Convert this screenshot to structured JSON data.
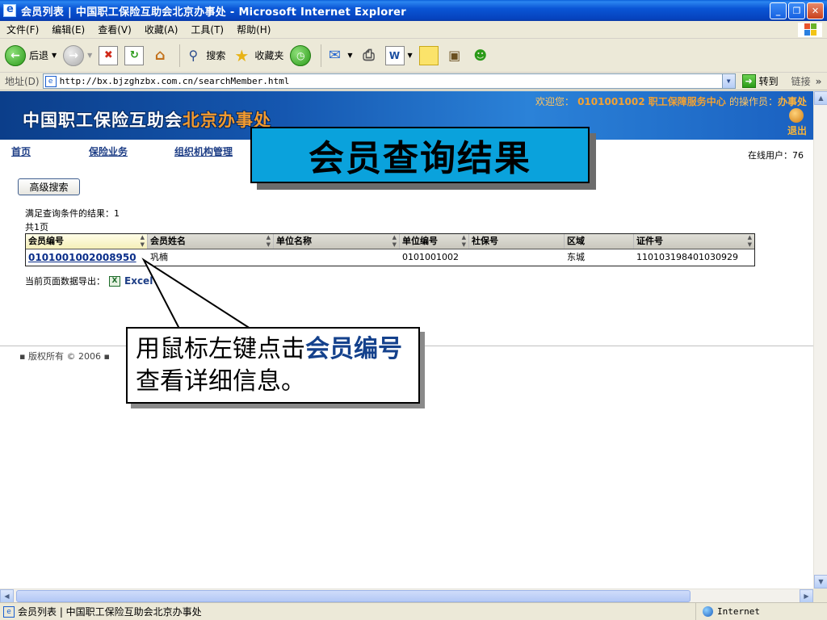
{
  "window": {
    "title": "会员列表 | 中国职工保险互助会北京办事处 - Microsoft Internet Explorer",
    "minimize": "_",
    "maximize": "❐",
    "close": "✕"
  },
  "menu": [
    {
      "label": "文件(F)"
    },
    {
      "label": "编辑(E)"
    },
    {
      "label": "查看(V)"
    },
    {
      "label": "收藏(A)"
    },
    {
      "label": "工具(T)"
    },
    {
      "label": "帮助(H)"
    }
  ],
  "toolbar": {
    "back": "后退",
    "search": "搜索",
    "favorites": "收藏夹"
  },
  "address": {
    "label": "地址(D)",
    "url": "http://bx.bjzghzbx.com.cn/searchMember.html",
    "go": "转到",
    "links": "链接"
  },
  "site": {
    "logo_main": "中国职工保险互助会",
    "logo_accent": "北京办事处",
    "welcome_prefix": "欢迎您：",
    "welcome_account": "0101001002",
    "welcome_org": "职工保障服务中心",
    "welcome_operator_label": "的操作员：",
    "welcome_operator": "办事处",
    "logout": "退出",
    "online_users": "在线用户：76"
  },
  "nav": [
    {
      "label": "首页"
    },
    {
      "label": "保险业务"
    },
    {
      "label": "组织机构管理"
    }
  ],
  "search": {
    "advanced_button": "高级搜索",
    "result_summary": "满足查询条件的结果：1",
    "page_count": "共1页"
  },
  "table": {
    "columns": [
      "会员编号",
      "会员姓名",
      "单位名称",
      "单位编号",
      "社保号",
      "区域",
      "证件号"
    ],
    "rows": [
      {
        "member_id": "0101001002008950",
        "member_name": "巩楠",
        "unit_name": "",
        "unit_id": "0101001002",
        "social_security_no": "",
        "area": "东城",
        "id_number": "110103198401030929"
      }
    ]
  },
  "export": {
    "label": "当前页面数据导出：",
    "link": "Excel"
  },
  "footer": {
    "text": "版权所有 © 2006"
  },
  "overlay": {
    "banner_title": "会员查询结果",
    "callout_before": "用鼠标左键点击",
    "callout_highlight": "会员编号",
    "callout_after": "查看详细信息。"
  },
  "status": {
    "page_title": "会员列表 | 中国职工保险互助会北京办事处",
    "zone": "Internet"
  },
  "colors": {
    "banner_bg": "#0aa2dc",
    "header_blue": "#1557b0",
    "accent_orange": "#f29a2e",
    "link_blue": "#1e3e86"
  },
  "icons": {
    "back": "back-arrow-icon",
    "forward": "forward-arrow-icon",
    "stop": "stop-icon",
    "refresh": "refresh-icon",
    "home": "home-icon",
    "search": "search-icon",
    "favorites": "star-icon",
    "history": "history-icon",
    "mail": "mail-icon",
    "print": "print-icon",
    "edit": "edit-icon",
    "discuss": "discuss-icon",
    "research": "research-icon",
    "messenger": "messenger-icon"
  }
}
